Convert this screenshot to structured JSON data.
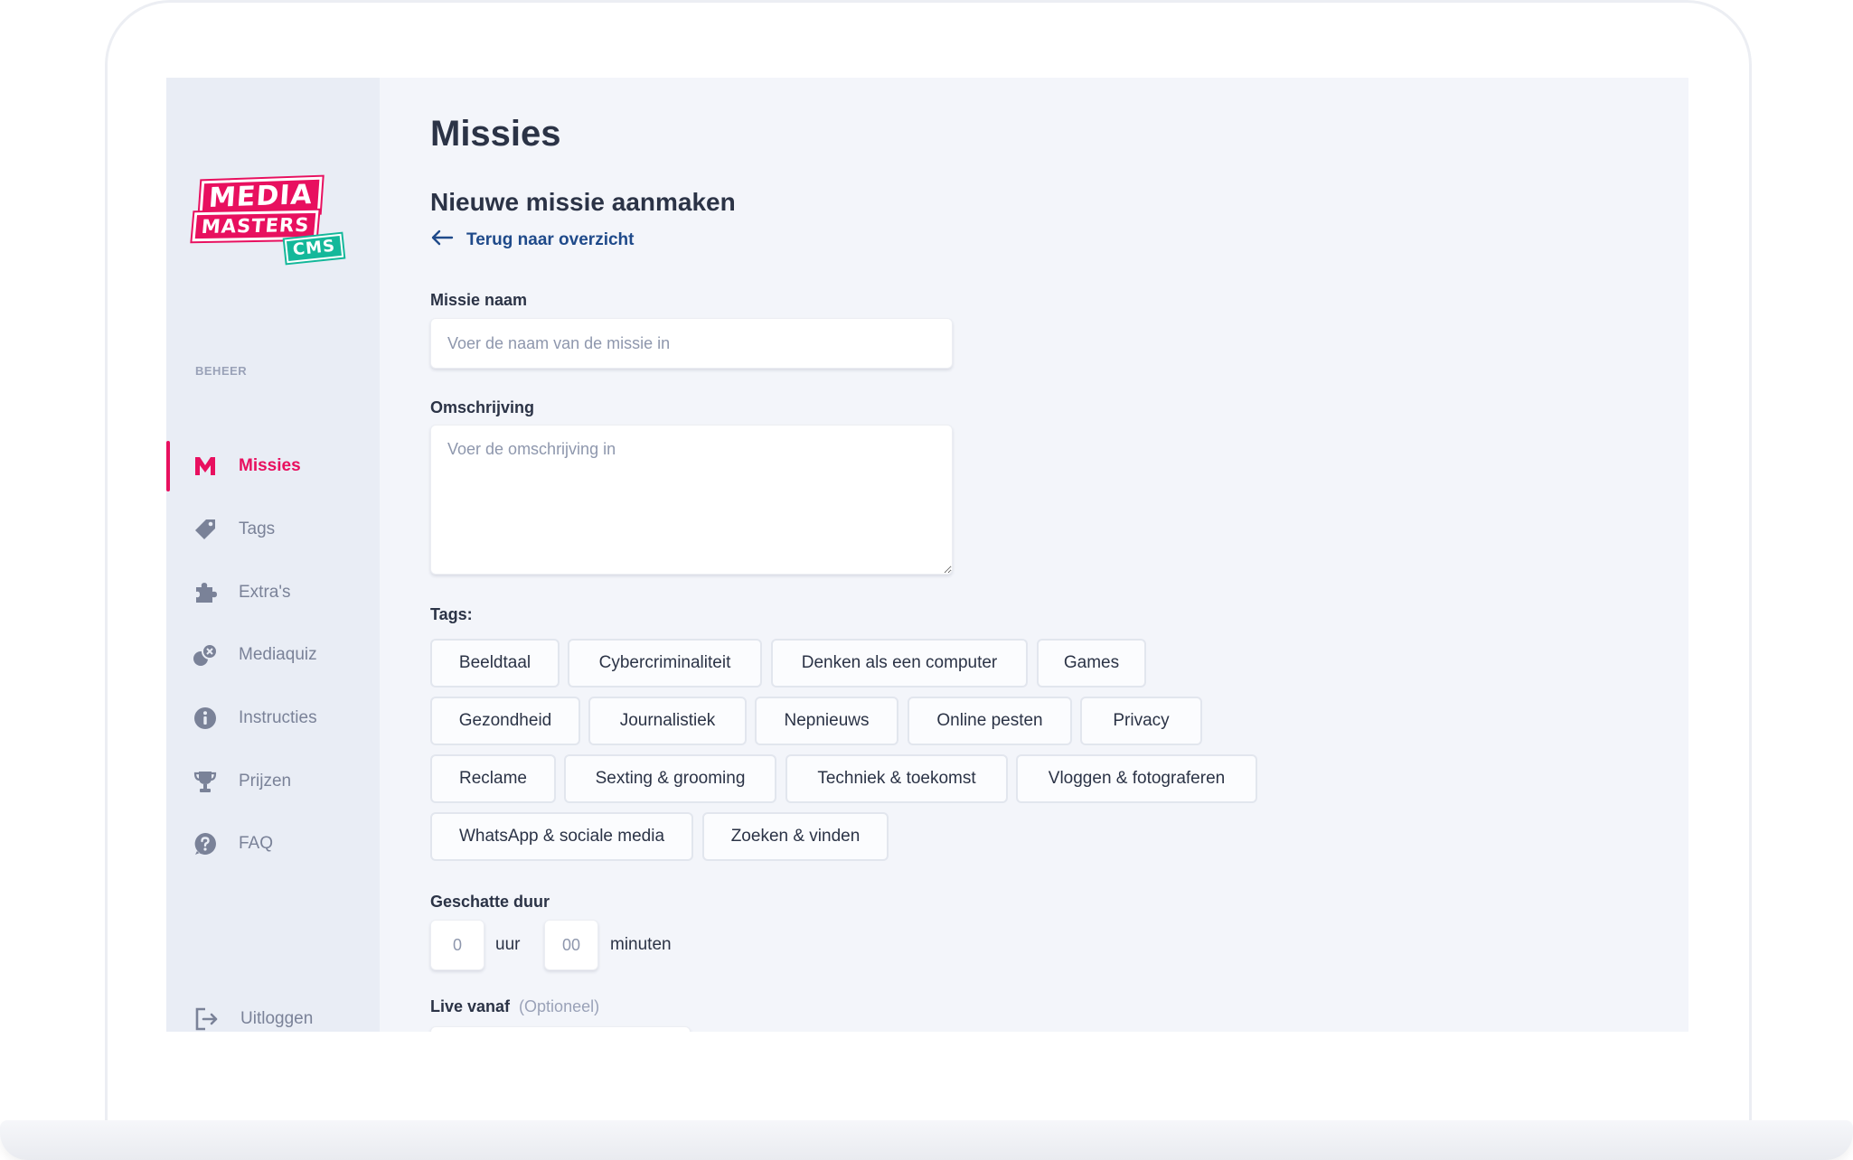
{
  "app": {
    "logo": {
      "line1": "MEDIA",
      "line2": "MASTERS",
      "line3": "CMS"
    },
    "accent_color": "#e8105f",
    "secondary_color": "#14b89a"
  },
  "sidebar": {
    "section_title": "BEHEER",
    "items": [
      {
        "label": "Missies",
        "icon": "m-logo-icon",
        "active": true
      },
      {
        "label": "Tags",
        "icon": "tag-icon",
        "active": false
      },
      {
        "label": "Extra's",
        "icon": "puzzle-icon",
        "active": false
      },
      {
        "label": "Mediaquiz",
        "icon": "quiz-icon",
        "active": false
      },
      {
        "label": "Instructies",
        "icon": "info-icon",
        "active": false
      },
      {
        "label": "Prijzen",
        "icon": "trophy-icon",
        "active": false
      },
      {
        "label": "FAQ",
        "icon": "question-icon",
        "active": false
      }
    ],
    "logout_label": "Uitloggen"
  },
  "main": {
    "page_title": "Missies",
    "form_title": "Nieuwe missie aanmaken",
    "back_link": "Terug naar overzicht",
    "fields": {
      "name_label": "Missie naam",
      "name_placeholder": "Voer de naam van de missie in",
      "description_label": "Omschrijving",
      "description_placeholder": "Voer de omschrijving in",
      "tags_label": "Tags:",
      "duration_label": "Geschatte duur",
      "hours_placeholder": "0",
      "hours_unit": "uur",
      "minutes_placeholder": "00",
      "minutes_unit": "minuten",
      "live_label": "Live vanaf",
      "live_optional": "(Optioneel)"
    },
    "tags": [
      "Beeldtaal",
      "Cybercriminaliteit",
      "Denken als een computer",
      "Games",
      "Gezondheid",
      "Journalistiek",
      "Nepnieuws",
      "Online pesten",
      "Privacy",
      "Reclame",
      "Sexting & grooming",
      "Techniek & toekomst",
      "Vloggen & fotograferen",
      "WhatsApp & sociale media",
      "Zoeken & vinden"
    ]
  }
}
